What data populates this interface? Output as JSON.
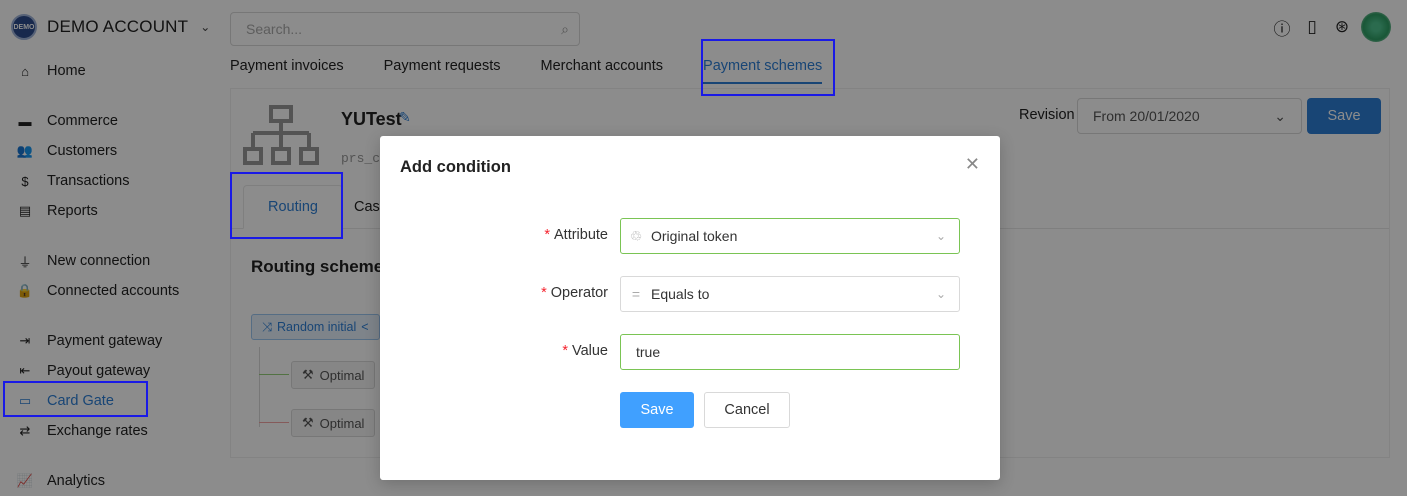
{
  "account": {
    "logo_text": "DEMO",
    "name": "DEMO ACCOUNT"
  },
  "sidebar": {
    "items": [
      {
        "label": "Home",
        "icon": "⌂"
      },
      {
        "label": "Commerce",
        "icon": "▬"
      },
      {
        "label": "Customers",
        "icon": "👥"
      },
      {
        "label": "Transactions",
        "icon": "$"
      },
      {
        "label": "Reports",
        "icon": "▤"
      },
      {
        "label": "New connection",
        "icon": "⏚"
      },
      {
        "label": "Connected accounts",
        "icon": "🔒"
      },
      {
        "label": "Payment gateway",
        "icon": "⇥"
      },
      {
        "label": "Payout gateway",
        "icon": "⇤"
      },
      {
        "label": "Card Gate",
        "icon": "▭"
      },
      {
        "label": "Exchange rates",
        "icon": "⇄"
      },
      {
        "label": "Analytics",
        "icon": "📈"
      }
    ]
  },
  "search": {
    "placeholder": "Search..."
  },
  "tabs": [
    {
      "label": "Payment invoices"
    },
    {
      "label": "Payment requests"
    },
    {
      "label": "Merchant accounts"
    },
    {
      "label": "Payment schemes"
    }
  ],
  "scheme": {
    "title": "YUTest",
    "subtitle": "prs_c",
    "revision_label": "Revision",
    "revision_value": "From 20/01/2020",
    "save_label": "Save",
    "inner_tabs": {
      "routing": "Routing",
      "cascade": "Casc"
    },
    "routing_title": "Routing scheme",
    "random_tag": "Random initial",
    "optimal_label": "Optimal"
  },
  "modal": {
    "title": "Add condition",
    "attribute_label": "Attribute",
    "attribute_value": "Original token",
    "operator_label": "Operator",
    "operator_value": "Equals to",
    "value_label": "Value",
    "value_value": "true",
    "save_label": "Save",
    "cancel_label": "Cancel"
  },
  "colors": {
    "accent": "#2d7fd6",
    "success_border": "#7ac454",
    "required": "#f5222d"
  }
}
